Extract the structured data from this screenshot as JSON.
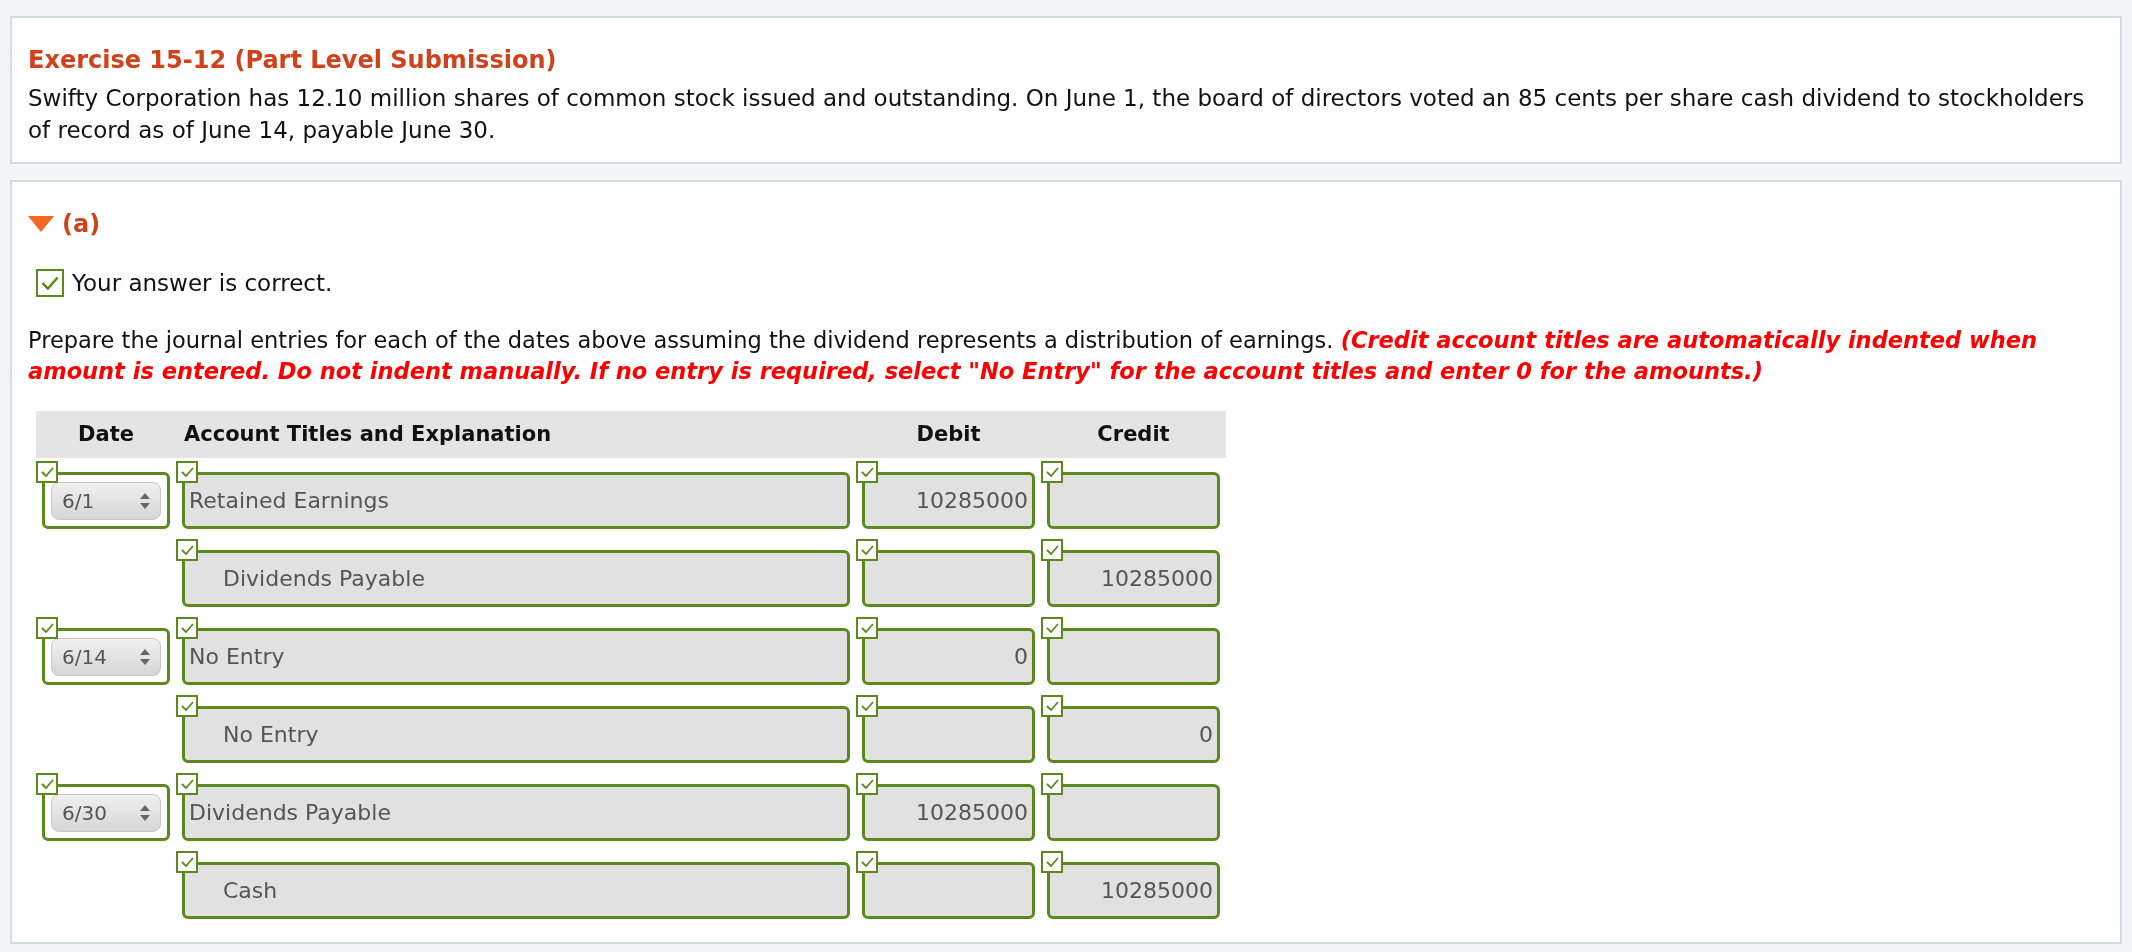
{
  "exercise": {
    "title": "Exercise 15-12 (Part Level Submission)",
    "text": "Swifty Corporation has 12.10 million shares of common stock issued and outstanding. On June 1, the board of directors voted an 85 cents per share cash dividend to stockholders of record as of June 14, payable June 30."
  },
  "part": {
    "label": "(a)",
    "expanded": true,
    "result": {
      "correct": true,
      "text": "Your answer is correct."
    },
    "instructions": "Prepare the journal entries for each of the dates above assuming the dividend represents a distribution of earnings.",
    "note": "(Credit account titles are automatically indented when amount is entered. Do not indent manually. If no entry is required, select \"No Entry\" for the account titles and enter 0 for the amounts.)"
  },
  "table": {
    "columns": [
      "Date",
      "Account Titles and Explanation",
      "Debit",
      "Credit"
    ],
    "entries": [
      {
        "date": "6/1",
        "date_correct": true,
        "lines": [
          {
            "account": "Retained Earnings",
            "indented": false,
            "debit": "10285000",
            "correct": true
          },
          {
            "account": "Dividends Payable",
            "indented": true,
            "credit": "10285000",
            "correct": true
          }
        ]
      },
      {
        "date": "6/14",
        "date_correct": true,
        "lines": [
          {
            "account": "No Entry",
            "indented": false,
            "debit": "0",
            "correct": true
          },
          {
            "account": "No Entry",
            "indented": true,
            "credit": "0",
            "correct": true
          }
        ]
      },
      {
        "date": "6/30",
        "date_correct": true,
        "lines": [
          {
            "account": "Dividends Payable",
            "indented": false,
            "debit": "10285000",
            "correct": true
          },
          {
            "account": "Cash",
            "indented": true,
            "credit": "10285000",
            "correct": true
          }
        ]
      }
    ]
  }
}
